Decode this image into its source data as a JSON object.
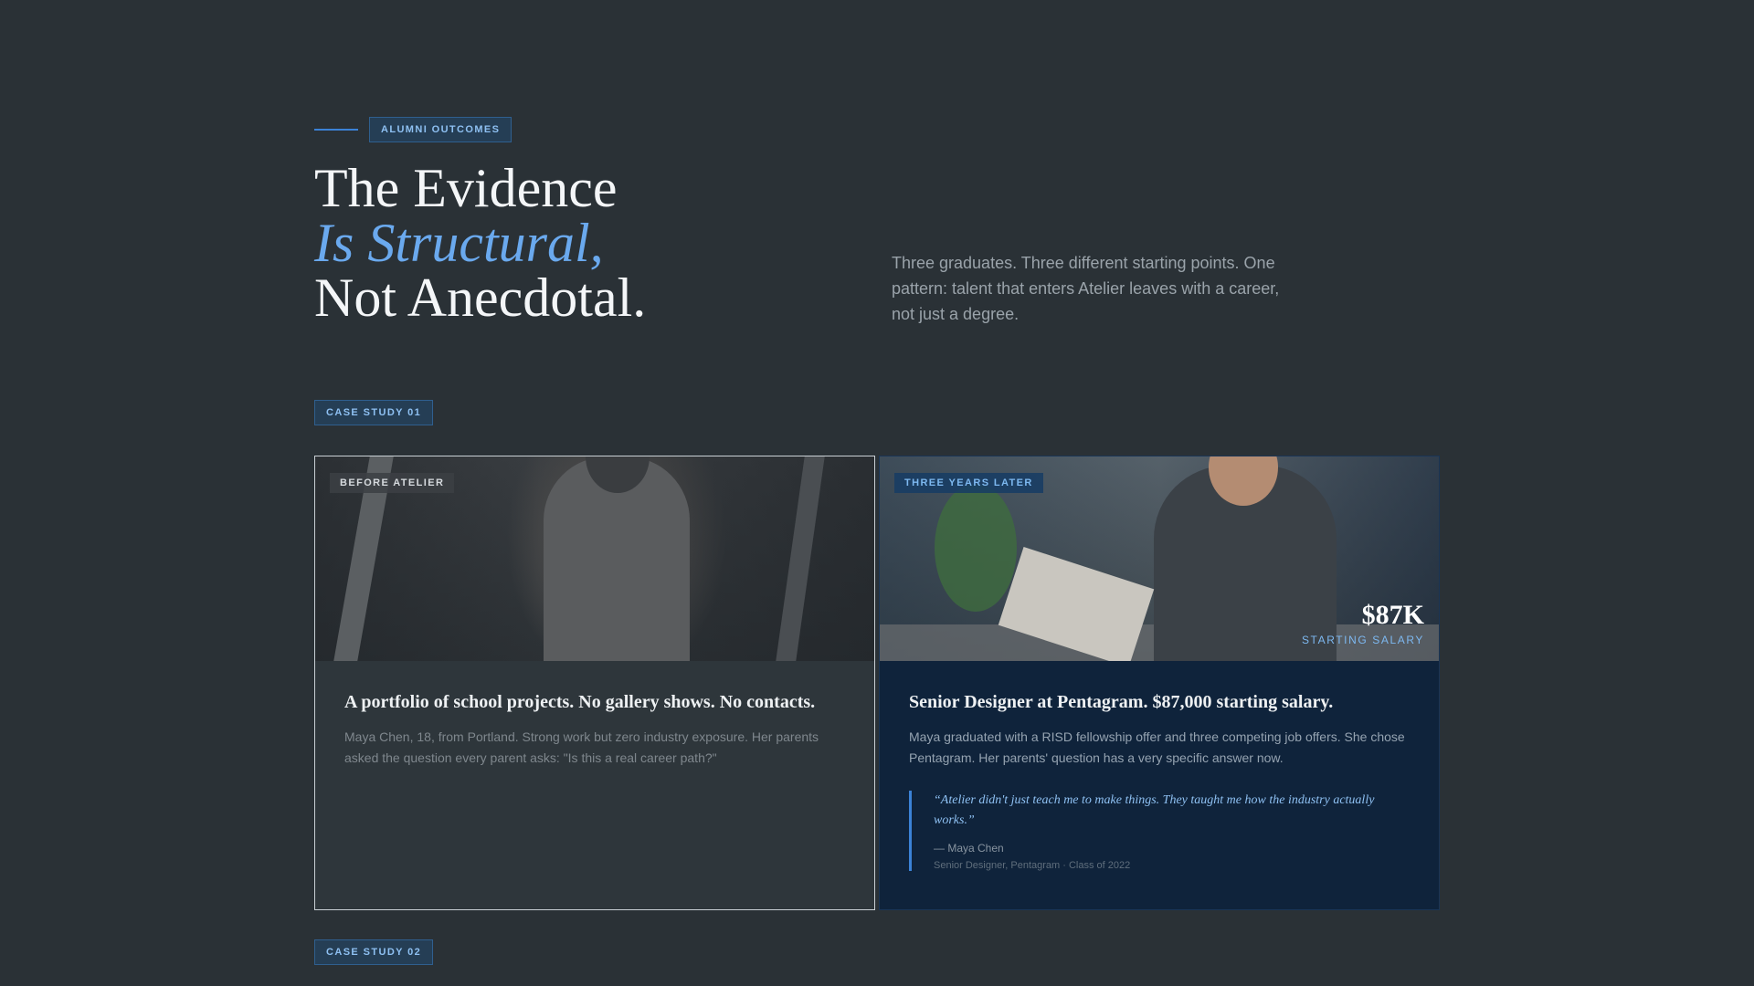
{
  "section": {
    "eyebrow": "ALUMNI OUTCOMES",
    "headline_line1": "The Evidence",
    "headline_line2": "Is Structural,",
    "headline_line3": "Not Anecdotal.",
    "intro": "Three graduates. Three different starting points. One pattern: talent that enters Atelier leaves with a career, not just a degree."
  },
  "case_study_1": {
    "tag": "CASE STUDY 01",
    "before": {
      "label": "BEFORE ATELIER",
      "title": "A portfolio of school projects. No gallery shows. No contacts.",
      "description": "Maya Chen, 18, from Portland. Strong work but zero industry exposure. Her parents asked the question every parent asks: \"Is this a real career path?\""
    },
    "after": {
      "label": "THREE YEARS LATER",
      "salary_value": "$87K",
      "salary_label": "STARTING SALARY",
      "title": "Senior Designer at Pentagram. $87,000 starting salary.",
      "description": "Maya graduated with a RISD fellowship offer and three competing job offers. She chose Pentagram. Her parents' question has a very specific answer now.",
      "quote": "“Atelier didn't just teach me to make things. They taught me how the industry actually works.”",
      "quote_author": "— Maya Chen",
      "quote_role": "Senior Designer, Pentagram · Class of 2022"
    }
  },
  "case_study_2": {
    "tag": "CASE STUDY 02"
  },
  "colors": {
    "background": "#2a3136",
    "accent": "#6aa9ee",
    "after_card": "#0f233b"
  }
}
